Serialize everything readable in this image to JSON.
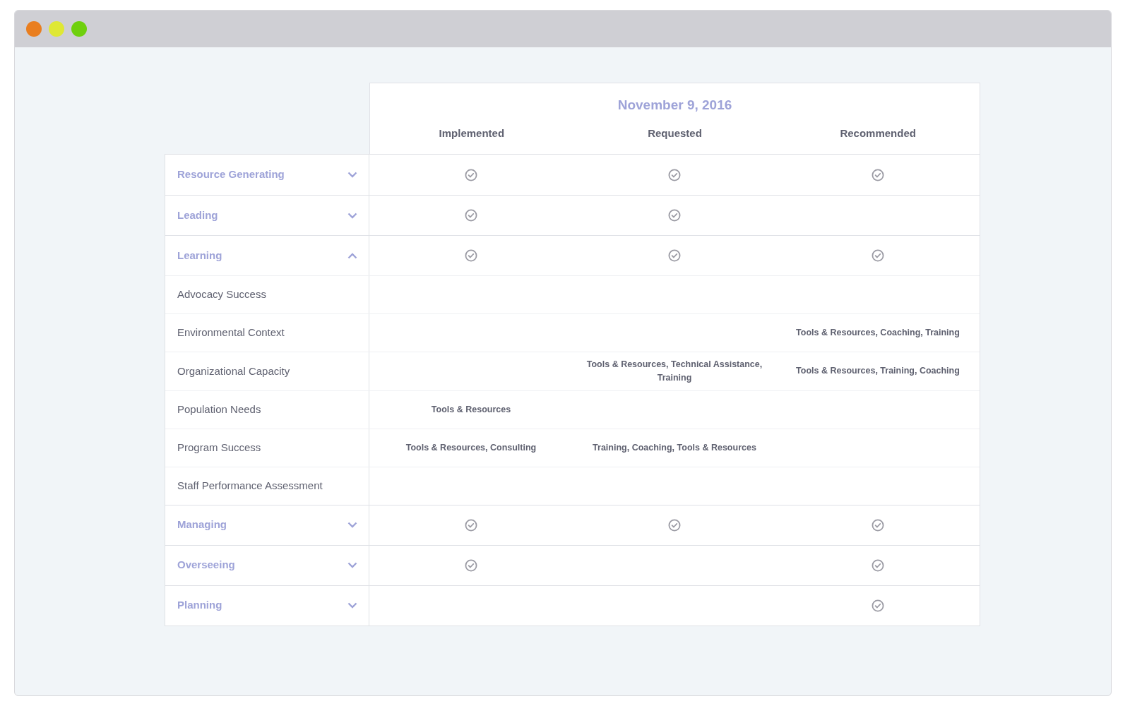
{
  "date": "November 9, 2016",
  "columns": [
    "Implemented",
    "Requested",
    "Recommended"
  ],
  "groups": [
    {
      "label": "Resource Generating",
      "expanded": false,
      "checks": [
        true,
        true,
        true
      ]
    },
    {
      "label": "Leading",
      "expanded": false,
      "checks": [
        true,
        true,
        false
      ]
    },
    {
      "label": "Learning",
      "expanded": true,
      "checks": [
        true,
        true,
        true
      ],
      "children": [
        {
          "label": "Advocacy Success",
          "cells": [
            null,
            null,
            null
          ]
        },
        {
          "label": "Environmental Context",
          "cells": [
            null,
            null,
            "Tools & Resources, Coaching, Training"
          ]
        },
        {
          "label": "Organizational Capacity",
          "cells": [
            null,
            "Tools & Resources, Technical Assistance, Training",
            "Tools & Resources, Training, Coaching"
          ]
        },
        {
          "label": "Population Needs",
          "cells": [
            "Tools & Resources",
            null,
            null
          ]
        },
        {
          "label": "Program Success",
          "cells": [
            "Tools & Resources, Consulting",
            "Training, Coaching, Tools & Resources",
            null
          ]
        },
        {
          "label": "Staff Performance Assessment",
          "cells": [
            null,
            null,
            null
          ]
        }
      ]
    },
    {
      "label": "Managing",
      "expanded": false,
      "checks": [
        true,
        true,
        true
      ]
    },
    {
      "label": "Overseeing",
      "expanded": false,
      "checks": [
        true,
        false,
        true
      ]
    },
    {
      "label": "Planning",
      "expanded": false,
      "checks": [
        false,
        false,
        true
      ]
    }
  ]
}
